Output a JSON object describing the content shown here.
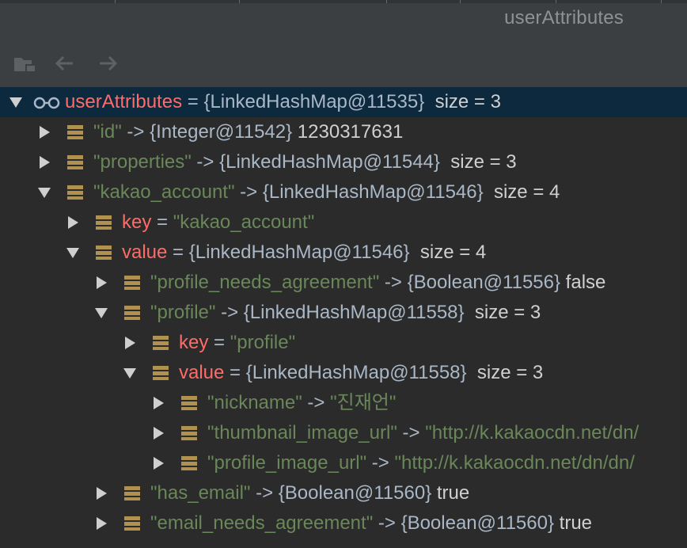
{
  "window": {
    "title": "userAttributes"
  },
  "toolbar": {
    "icons": [
      "folder-icon",
      "back-arrow-icon",
      "forward-arrow-icon"
    ]
  },
  "colors": {
    "background": "#2b2b2b",
    "panel": "#3c3f41",
    "selected_row": "#0d293e",
    "key_name": "#ff6b68",
    "string_value": "#6a8759",
    "default_text": "#a9b7c6",
    "field_icon": "#b0914f"
  },
  "tree": {
    "root": {
      "name": "userAttributes",
      "eq": " = ",
      "type": "{LinkedHashMap@11535}",
      "size": "  size = 3"
    },
    "rows": [
      {
        "key": "\"id\"",
        "arrow": " -> ",
        "type": "{Integer@11542}",
        "val": " 1230317631"
      },
      {
        "key": "\"properties\"",
        "arrow": " -> ",
        "type": "{LinkedHashMap@11544}",
        "val": "  size = 3"
      },
      {
        "key": "\"kakao_account\"",
        "arrow": " -> ",
        "type": "{LinkedHashMap@11546}",
        "val": "  size = 4"
      },
      {
        "name": "key",
        "eq": " = ",
        "val": "\"kakao_account\""
      },
      {
        "name": "value",
        "eq": " = ",
        "type": "{LinkedHashMap@11546}",
        "val": "  size = 4"
      },
      {
        "key": "\"profile_needs_agreement\"",
        "arrow": " -> ",
        "type": "{Boolean@11556}",
        "val": " false"
      },
      {
        "key": "\"profile\"",
        "arrow": " -> ",
        "type": "{LinkedHashMap@11558}",
        "val": "  size = 3"
      },
      {
        "name": "key",
        "eq": " = ",
        "val": "\"profile\""
      },
      {
        "name": "value",
        "eq": " = ",
        "type": "{LinkedHashMap@11558}",
        "val": "  size = 3"
      },
      {
        "key": "\"nickname\"",
        "arrow": " -> ",
        "val": "\"진재언\""
      },
      {
        "key": "\"thumbnail_image_url\"",
        "arrow": " -> ",
        "val": "\"http://k.kakaocdn.net/dn/"
      },
      {
        "key": "\"profile_image_url\"",
        "arrow": " -> ",
        "val": "\"http://k.kakaocdn.net/dn/dn/"
      },
      {
        "key": "\"has_email\"",
        "arrow": " -> ",
        "type": "{Boolean@11560}",
        "val": " true"
      },
      {
        "key": "\"email_needs_agreement\"",
        "arrow": " -> ",
        "type": "{Boolean@11560}",
        "val": " true"
      }
    ]
  }
}
